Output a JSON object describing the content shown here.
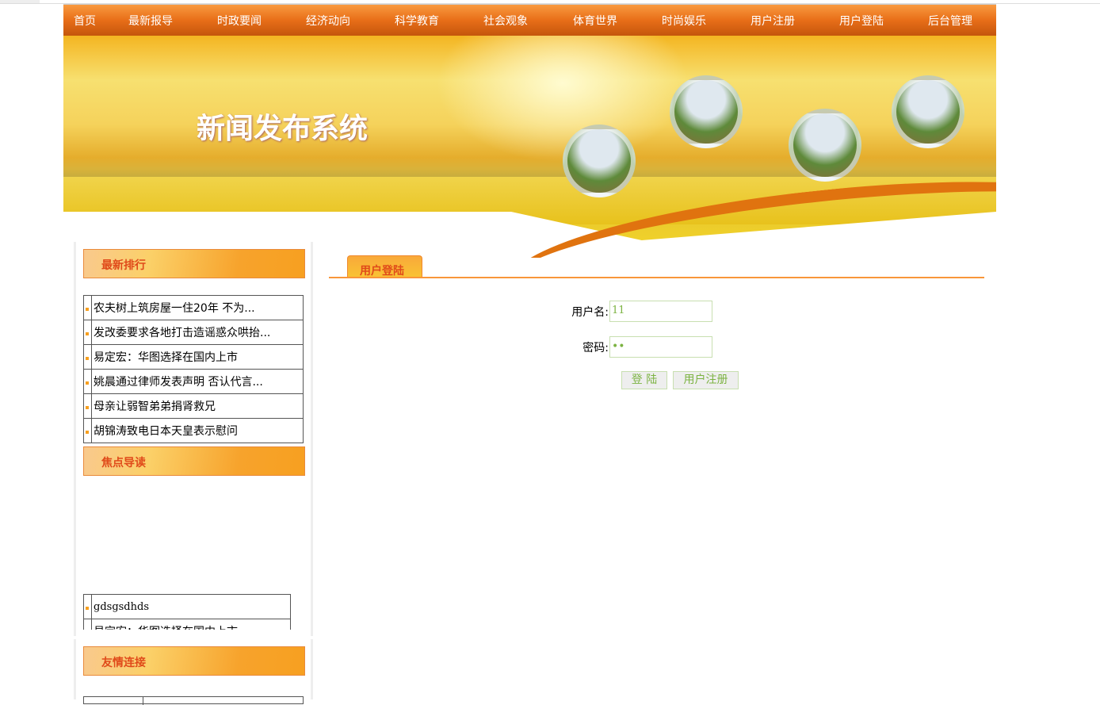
{
  "nav": [
    "首页",
    "最新报导",
    "时政要闻",
    "经济动向",
    "科学教育",
    "社会观象",
    "体育世界",
    "时尚娱乐",
    "用户注册",
    "用户登陆",
    "后台管理"
  ],
  "banner": {
    "title": "新闻发布系统"
  },
  "sidebar": {
    "latest": {
      "title": "最新排行",
      "items": [
        "农夫树上筑房屋一住20年 不为...",
        "发改委要求各地打击造谣惑众哄抬...",
        "易定宏：华图选择在国内上市",
        "姚晨通过律师发表声明 否认代言...",
        "母亲让弱智弟弟捐肾救兄",
        "胡锦涛致电日本天皇表示慰问"
      ]
    },
    "focus": {
      "title": "焦点导读",
      "items": [
        "gdsgsdhds",
        "易定宏：华图选择在国内上市"
      ]
    },
    "links": {
      "title": "友情连接"
    }
  },
  "login": {
    "tab": "用户登陆",
    "username_label": "用户名:",
    "username_value": "11",
    "password_label": "密码:",
    "password_value": "••",
    "login_button": "登 陆",
    "register_button": "用户注册"
  }
}
